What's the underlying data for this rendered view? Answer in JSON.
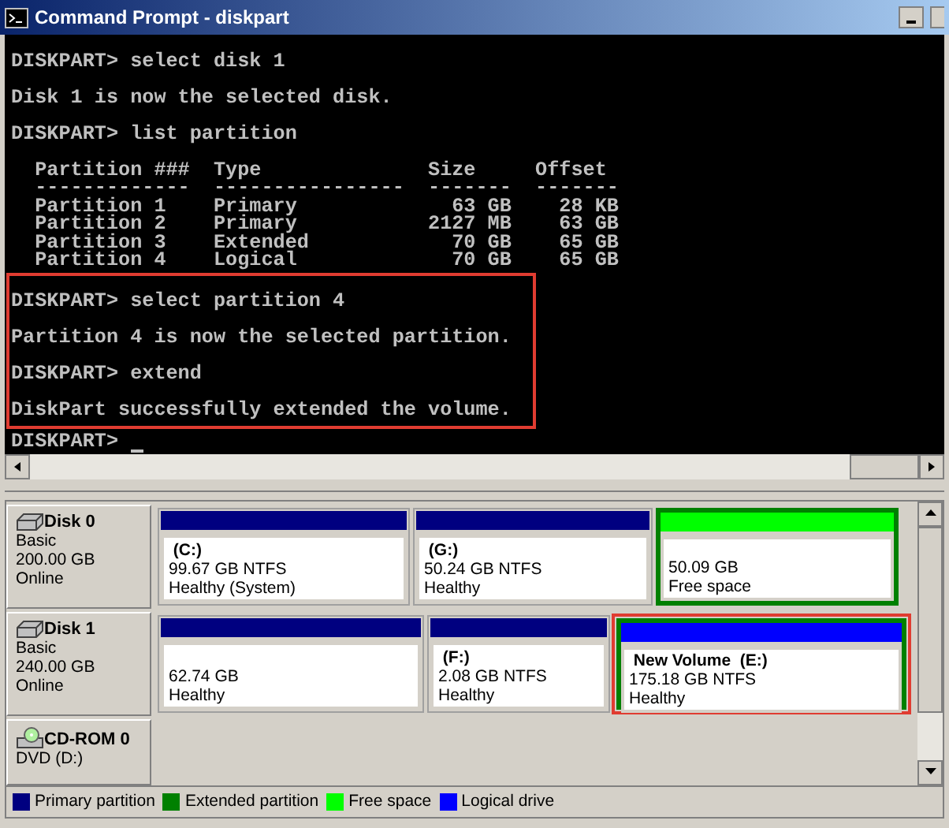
{
  "window": {
    "title": "Command Prompt - diskpart"
  },
  "console": {
    "sections": [
      {
        "highlighted": false,
        "blocks": [
          {
            "kind": "line",
            "text": "DISKPART> select disk 1"
          },
          {
            "kind": "line",
            "text": "Disk 1 is now the selected disk."
          },
          {
            "kind": "line",
            "text": "DISKPART> list partition"
          },
          {
            "kind": "table",
            "lines": [
              "  Partition ###  Type              Size     Offset",
              "  -------------  ----------------  -------  -------",
              "  Partition 1    Primary             63 GB    28 KB",
              "  Partition 2    Primary           2127 MB    63 GB",
              "  Partition 3    Extended            70 GB    65 GB",
              "  Partition 4    Logical             70 GB    65 GB"
            ]
          }
        ]
      },
      {
        "highlighted": true,
        "blocks": [
          {
            "kind": "line",
            "text": "DISKPART> select partition 4"
          },
          {
            "kind": "line",
            "text": "Partition 4 is now the selected partition."
          },
          {
            "kind": "line",
            "text": "DISKPART> extend"
          },
          {
            "kind": "line",
            "text": "DiskPart successfully extended the volume."
          }
        ]
      }
    ],
    "prompt": "DISKPART> "
  },
  "disks": [
    {
      "kind": "disk",
      "name": "Disk 0",
      "type": "Basic",
      "capacity": "200.00 GB",
      "status": "Online",
      "partitions": [
        {
          "kind": "primary",
          "in_extended": false,
          "highlighted": false,
          "name": "(C:)",
          "size": "99.67 GB NTFS",
          "status": "Healthy (System)"
        },
        {
          "kind": "primary",
          "in_extended": false,
          "highlighted": false,
          "name": "(G:)",
          "size": "50.24 GB NTFS",
          "status": "Healthy"
        },
        {
          "kind": "free",
          "in_extended": true,
          "highlighted": false,
          "size": "50.09 GB",
          "status": "Free space"
        }
      ]
    },
    {
      "kind": "disk",
      "name": "Disk 1",
      "type": "Basic",
      "capacity": "240.00 GB",
      "status": "Online",
      "partitions": [
        {
          "kind": "primary",
          "in_extended": false,
          "highlighted": false,
          "size": "62.74 GB",
          "status": "Healthy"
        },
        {
          "kind": "primary",
          "in_extended": false,
          "highlighted": false,
          "name": "(F:)",
          "size": "2.08 GB NTFS",
          "status": "Healthy"
        },
        {
          "kind": "logical",
          "in_extended": true,
          "highlighted": true,
          "name": "New Volume  (E:)",
          "size": "175.18 GB NTFS",
          "status": "Healthy"
        }
      ]
    },
    {
      "kind": "cdrom",
      "name": "CD-ROM 0",
      "type": "DVD (D:)"
    }
  ],
  "legend": [
    {
      "label": "Primary partition",
      "color": "#000080"
    },
    {
      "label": "Extended partition",
      "color": "#008000"
    },
    {
      "label": "Free space",
      "color": "#00ff00"
    },
    {
      "label": "Logical drive",
      "color": "#0000ff"
    }
  ]
}
